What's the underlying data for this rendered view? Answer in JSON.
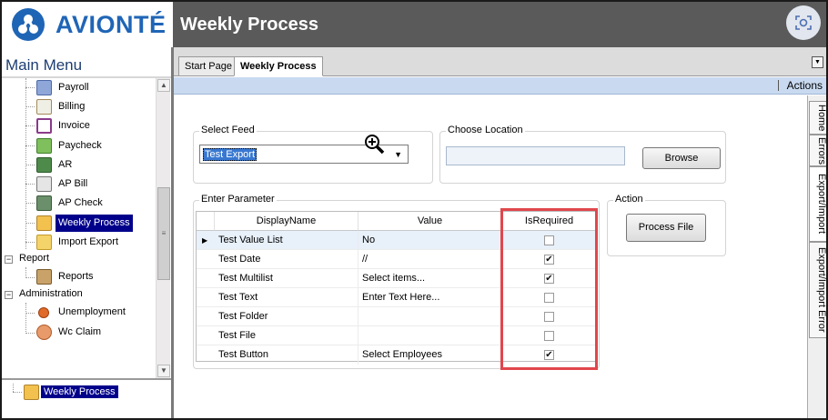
{
  "brand": {
    "logo_text": "AVIONTÉ",
    "color": "#1f65b6"
  },
  "window": {
    "title": "Weekly Process"
  },
  "sidebar": {
    "title": "Main Menu",
    "items": [
      {
        "label": "Payroll",
        "icon": "payroll-icon"
      },
      {
        "label": "Billing",
        "icon": "billing-icon"
      },
      {
        "label": "Invoice",
        "icon": "invoice-icon"
      },
      {
        "label": "Paycheck",
        "icon": "paycheck-icon"
      },
      {
        "label": "AR",
        "icon": "ar-icon"
      },
      {
        "label": "AP Bill",
        "icon": "ap-bill-icon"
      },
      {
        "label": "AP Check",
        "icon": "ap-check-icon"
      },
      {
        "label": "Weekly Process",
        "icon": "weekly-process-icon",
        "selected": true
      },
      {
        "label": "Import Export",
        "icon": "import-export-icon"
      }
    ],
    "report": {
      "label": "Report",
      "items": [
        {
          "label": "Reports",
          "icon": "reports-icon"
        }
      ]
    },
    "administration": {
      "label": "Administration",
      "items": [
        {
          "label": "Unemployment",
          "icon": "unemployment-icon"
        },
        {
          "label": "Wc Claim",
          "icon": "wc-claim-icon"
        }
      ]
    },
    "footer_item": "Weekly Process"
  },
  "tabs": [
    {
      "label": "Start Page"
    },
    {
      "label": "Weekly Process",
      "active": true
    }
  ],
  "actions_label": "Actions",
  "right_tabs": [
    {
      "label": "Home"
    },
    {
      "label": "Errors"
    },
    {
      "label": "Export/Import"
    },
    {
      "label": "Export/Import Error"
    }
  ],
  "select_feed": {
    "legend": "Select Feed",
    "value": "Test Export"
  },
  "choose_location": {
    "legend": "Choose Location",
    "value": "",
    "browse_label": "Browse"
  },
  "enter_parameter": {
    "legend": "Enter Parameter",
    "columns": [
      "DisplayName",
      "Value",
      "IsRequired"
    ],
    "rows": [
      {
        "name": "Test Value List",
        "value": "No",
        "required": false
      },
      {
        "name": "Test Date",
        "value": "//",
        "required": true
      },
      {
        "name": "Test Multilist",
        "value": "Select items...",
        "required": true
      },
      {
        "name": "Test Text",
        "value": "Enter Text Here...",
        "required": false
      },
      {
        "name": "Test Folder",
        "value": "",
        "required": false
      },
      {
        "name": "Test File",
        "value": "",
        "required": false
      },
      {
        "name": "Test Button",
        "value": "Select Employees",
        "required": true
      }
    ]
  },
  "action": {
    "legend": "Action",
    "button_label": "Process File"
  },
  "highlight_color": "#e0474c"
}
